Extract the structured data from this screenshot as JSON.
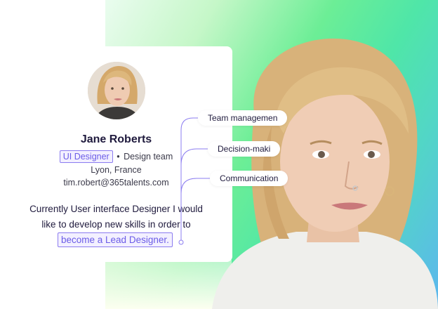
{
  "profile": {
    "name": "Jane Roberts",
    "role_tag": "UI Designer",
    "separator": "•",
    "team": "Design team",
    "location": "Lyon, France",
    "email": "tim.robert@365talents.com",
    "bio_line1": "Currently User interface Designer I would",
    "bio_line2": "like to develop new skills in order to",
    "bio_highlight": "become a Lead Designer."
  },
  "skills": [
    {
      "label": "Team managemen"
    },
    {
      "label": "Decision-maki"
    },
    {
      "label": "Communication"
    }
  ],
  "colors": {
    "accent": "#6b5ce7",
    "accent_border": "#8b7cf0",
    "text_dark": "#1f1a3d",
    "gradient_green": "#6cee96",
    "gradient_blue": "#5cb6ee"
  }
}
